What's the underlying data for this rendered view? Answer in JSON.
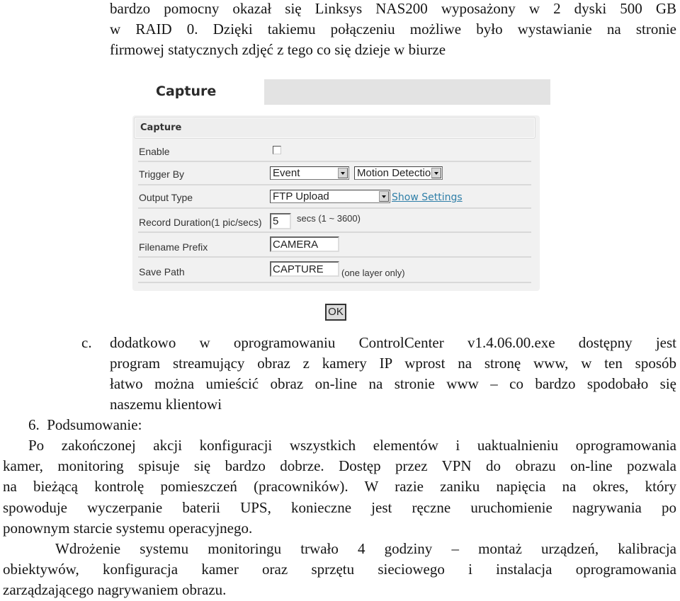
{
  "document": {
    "top_paragraph_lines": [
      "bardzo pomocny okazał się Linksys NAS200 wyposażony w 2 dyski 500 GB",
      "w RAID 0. Dzięki takiemu połączeniu możliwe było wystawianie na stronie",
      "firmowej statycznych zdjęć z tego co się dzieje w biurze"
    ],
    "item_c": {
      "marker": "c.",
      "lines": [
        "dodatkowo w oprogramowaniu ControlCenter v1.4.06.00.exe dostępny jest",
        "program streamujący obraz z kamery IP wprost na stronę www, w ten sposób",
        "łatwo można umieścić obraz on-line na stronie www – co bardzo spodobało się",
        "naszemu klientowi"
      ]
    },
    "section6": {
      "heading": "6.  Podsumowanie:",
      "paragraph1_lines": [
        "Po zakończonej akcji konfiguracji wszystkich elementów i uaktualnieniu oprogramowania",
        "kamer, monitoring spisuje się bardzo dobrze. Dostęp przez VPN do obrazu on-line pozwala",
        "na bieżącą kontrolę pomieszczeń (pracowników). W razie zaniku napięcia na okres, który",
        "spowoduje wyczerpanie baterii UPS, konieczne jest ręczne uruchomienie nagrywania po",
        "ponownym starcie systemu operacyjnego."
      ],
      "paragraph2_lines": [
        "Wdrożenie systemu monitoringu trwało 4 godziny – montaż urządzeń, kalibracja",
        "obiektywów, konfiguracja kamer oraz sprzętu sieciowego i instalacja oprogramowania",
        "zarządzającego nagrywaniem obrazu."
      ]
    }
  },
  "capture_screenshot": {
    "page_title": "Capture",
    "panel_title": "Capture",
    "rows": {
      "enable": {
        "label": "Enable",
        "checked": false
      },
      "trigger_by": {
        "label": "Trigger By",
        "select1": "Event",
        "select2": "Motion Detection"
      },
      "output_type": {
        "label": "Output Type",
        "select": "FTP Upload",
        "link": "Show Settings"
      },
      "record_duration": {
        "label": "Record Duration(1 pic/secs)",
        "value": "5",
        "hint": "secs (1 ~ 3600)"
      },
      "filename_prefix": {
        "label": "Filename Prefix",
        "value": "CAMERA"
      },
      "save_path": {
        "label": "Save Path",
        "value": "CAPTURE",
        "hint": "(one layer only)"
      }
    },
    "ok_label": "OK",
    "colors": {
      "link": "#2f7fa8",
      "panel_bg": "#f1f1f1",
      "title_bar": "#e3e3e3"
    }
  }
}
